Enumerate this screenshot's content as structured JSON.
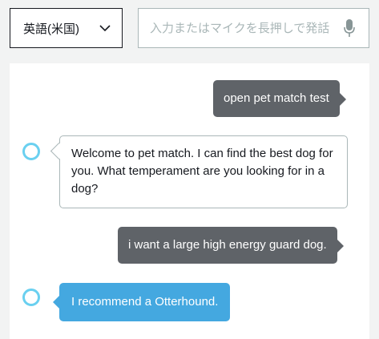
{
  "language_select": {
    "selected": "英語(米国)"
  },
  "utterance_input": {
    "placeholder": "入力またはマイクを長押しで発話"
  },
  "conversation": [
    {
      "speaker": "user",
      "text": "open pet match test"
    },
    {
      "speaker": "alexa",
      "text": "Welcome to pet match. I can find the best dog for you. What temperament are you looking for in a dog?"
    },
    {
      "speaker": "user",
      "text": "i want a large high energy guard dog."
    },
    {
      "speaker": "alexa",
      "text": "I recommend a Otterhound."
    }
  ],
  "colors": {
    "user_bubble": "#5f6368",
    "alexa_highlight": "#44a8e0",
    "alexa_avatar_ring": "#6ad0f0"
  }
}
